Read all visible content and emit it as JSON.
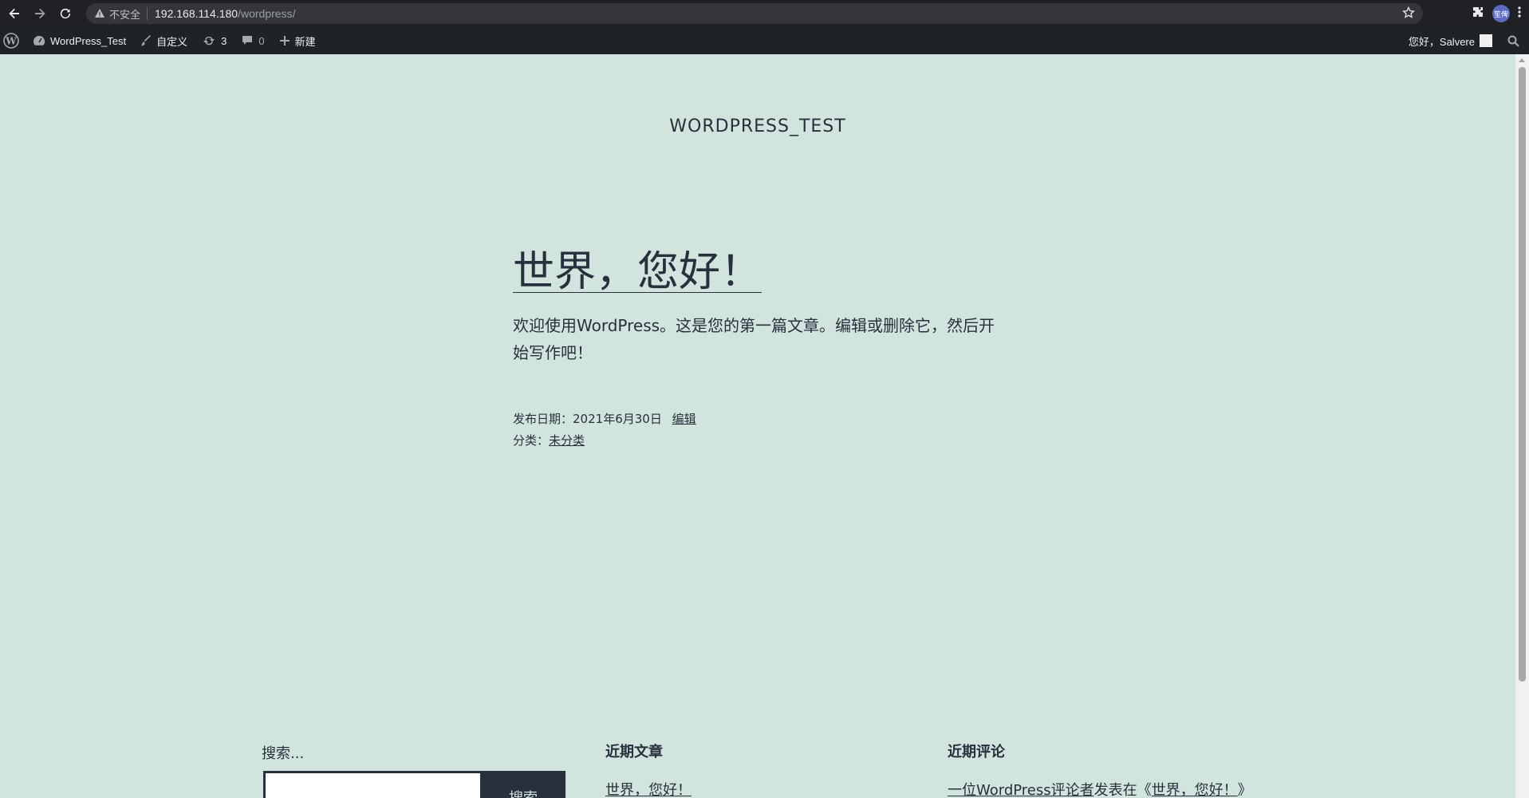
{
  "browser": {
    "security_label": "不安全",
    "url_host": "192.168.114.180",
    "url_path": "/wordpress/",
    "profile_initials": "笙俾"
  },
  "adminbar": {
    "site_name": "WordPress_Test",
    "customize": "自定义",
    "updates_count": "3",
    "comments_count": "0",
    "new_label": "新建",
    "greeting": "您好，Salvere"
  },
  "site": {
    "title": "WORDPRESS_TEST"
  },
  "post": {
    "title": "世界，您好！",
    "excerpt_line1": "欢迎使用WordPress。这是您的第一篇文章。编辑或删除它，然后开",
    "excerpt_line2": "始写作吧！",
    "date_prefix": "发布日期：",
    "date": "2021年6月30日",
    "edit_label": "编辑",
    "category_prefix": "分类：",
    "category": "未分类"
  },
  "widgets": {
    "search_label": "搜索...",
    "search_button": "搜索",
    "recent_posts_heading": "近期文章",
    "recent_post_1": "世界，您好！",
    "recent_comments_heading": "近期评论",
    "recent_comment_author": "一位WordPress评论者",
    "recent_comment_mid": "发表在《",
    "recent_comment_post": "世界，您好！",
    "recent_comment_end": "》"
  },
  "colors": {
    "page_bg": "#d1e4dd",
    "text": "#28303d",
    "adminbar_bg": "#1d2327",
    "chrome_bg": "#202124"
  }
}
